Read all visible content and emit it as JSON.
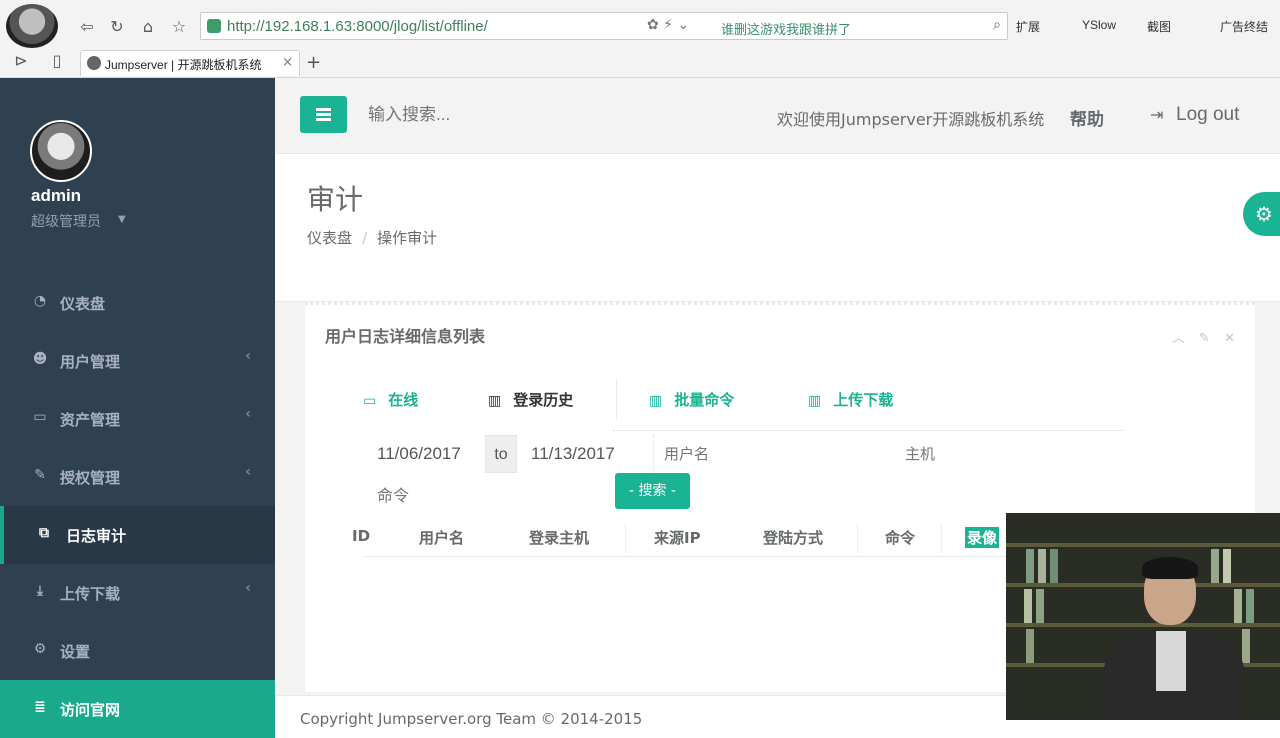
{
  "browser": {
    "url": "http://192.168.1.63:8000/jlog/list/offline/",
    "search_hint": "谁删这游戏我跟谁拼了",
    "extensions": [
      "扩展",
      "YSlow",
      "截图",
      "广告终结"
    ],
    "tab_title": "Jumpserver | 开源跳板机系统"
  },
  "sidebar": {
    "profile": {
      "name": "admin",
      "role": "超级管理员"
    },
    "items": [
      {
        "label": "仪表盘",
        "icon": "dashboard-icon",
        "arrow": false
      },
      {
        "label": "用户管理",
        "icon": "users-icon",
        "arrow": true
      },
      {
        "label": "资产管理",
        "icon": "inbox-icon",
        "arrow": true
      },
      {
        "label": "授权管理",
        "icon": "edit-icon",
        "arrow": true
      },
      {
        "label": "日志审计",
        "icon": "copy-icon",
        "arrow": false,
        "active": true
      },
      {
        "label": "上传下载",
        "icon": "download-icon",
        "arrow": true
      },
      {
        "label": "设置",
        "icon": "gears-icon",
        "arrow": false
      },
      {
        "label": "访问官网",
        "icon": "database-icon",
        "arrow": false,
        "highlight": true
      }
    ]
  },
  "topnav": {
    "search_placeholder": "输入搜索...",
    "welcome": "欢迎使用Jumpserver开源跳板机系统",
    "help": "帮助",
    "logout": "Log out"
  },
  "heading": {
    "title": "审计",
    "breadcrumb": [
      "仪表盘",
      "操作审计"
    ]
  },
  "ibox": {
    "title": "用户日志详细信息列表",
    "tabs": [
      "在线",
      "登录历史",
      "批量命令",
      "上传下载"
    ],
    "filters": {
      "date_from": "11/06/2017",
      "to_label": "to",
      "date_to": "11/13/2017",
      "user_placeholder": "用户名",
      "host_placeholder": "主机",
      "command_placeholder": "命令",
      "search_button": "- 搜索 -"
    },
    "columns": [
      "ID",
      "用户名",
      "登录主机",
      "来源IP",
      "登陆方式",
      "命令",
      "录像"
    ]
  },
  "footer": {
    "text": "Copyright Jumpserver.org Team © 2014-2015"
  },
  "colors": {
    "sidebar_bg": "#2f4050",
    "accent": "#1ab394",
    "text": "#676a6c"
  }
}
